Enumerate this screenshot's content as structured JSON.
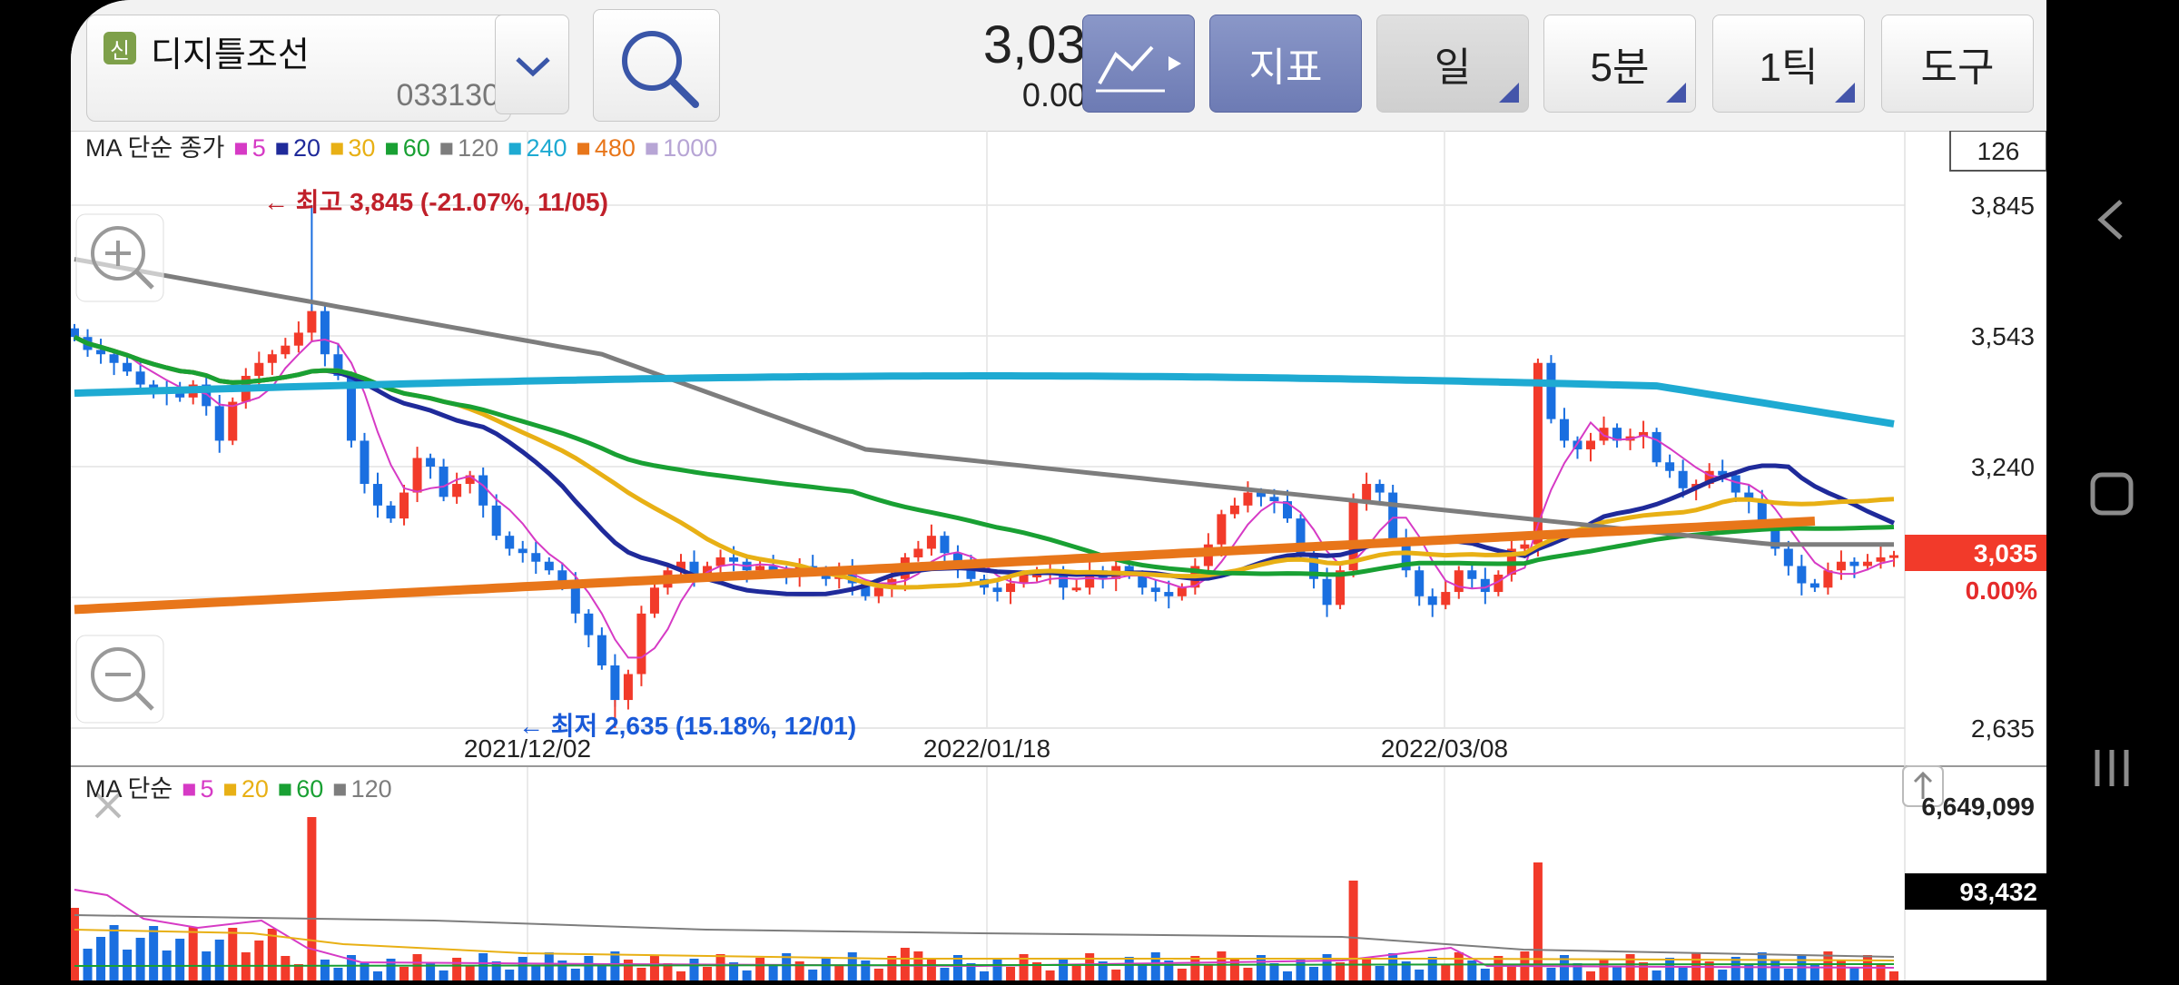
{
  "stock": {
    "badge": "신",
    "name": "디지틀조선",
    "code": "033130",
    "price": "3,035",
    "change_pct": "0.00%"
  },
  "toolbar": {
    "indicator_label": "지표",
    "day_label": "일",
    "minute_label": "5분",
    "tick_label": "1틱",
    "tools_label": "도구"
  },
  "main_legend": {
    "title": "MA 단순 종가",
    "items": [
      {
        "label": "5",
        "color": "#d63ac5"
      },
      {
        "label": "20",
        "color": "#1f2a9a"
      },
      {
        "label": "30",
        "color": "#e8b015"
      },
      {
        "label": "60",
        "color": "#19a033"
      },
      {
        "label": "120",
        "color": "#7d7d7d"
      },
      {
        "label": "240",
        "color": "#1eaad2"
      },
      {
        "label": "480",
        "color": "#e8761a"
      },
      {
        "label": "1000",
        "color": "#b7a5d5"
      }
    ]
  },
  "volume_legend": {
    "title": "MA 단순",
    "items": [
      {
        "label": "5",
        "color": "#d63ac5"
      },
      {
        "label": "20",
        "color": "#e8b015"
      },
      {
        "label": "60",
        "color": "#19a033"
      },
      {
        "label": "120",
        "color": "#7d7d7d"
      }
    ]
  },
  "annotations": {
    "high": "← 최고 3,845 (-21.07%, 11/05)",
    "low": "← 최저 2,635 (15.18%, 12/01)",
    "count_box": "126"
  },
  "price_tag": {
    "value": "3,035",
    "pct": "0.00%"
  },
  "volume_tag": "93,432",
  "colors": {
    "up": "#f23a2a",
    "down": "#1a6fe0",
    "tag_red": "#f23a2a"
  },
  "chart_data": {
    "type": "candlestick",
    "x_ticks": [
      "2021/12/02",
      "2022/01/18",
      "2022/03/08"
    ],
    "y_ticks": [
      "3,845",
      "3,543",
      "3,240",
      "2,635"
    ],
    "ylim": [
      2635,
      3845
    ],
    "volume_ticks": [
      "6,649,099"
    ],
    "volume_ylim": [
      0,
      6649099
    ],
    "high": {
      "value": 3845,
      "date": "11/05"
    },
    "low": {
      "value": 2635,
      "date": "12/01"
    },
    "last_close": 3035
  }
}
